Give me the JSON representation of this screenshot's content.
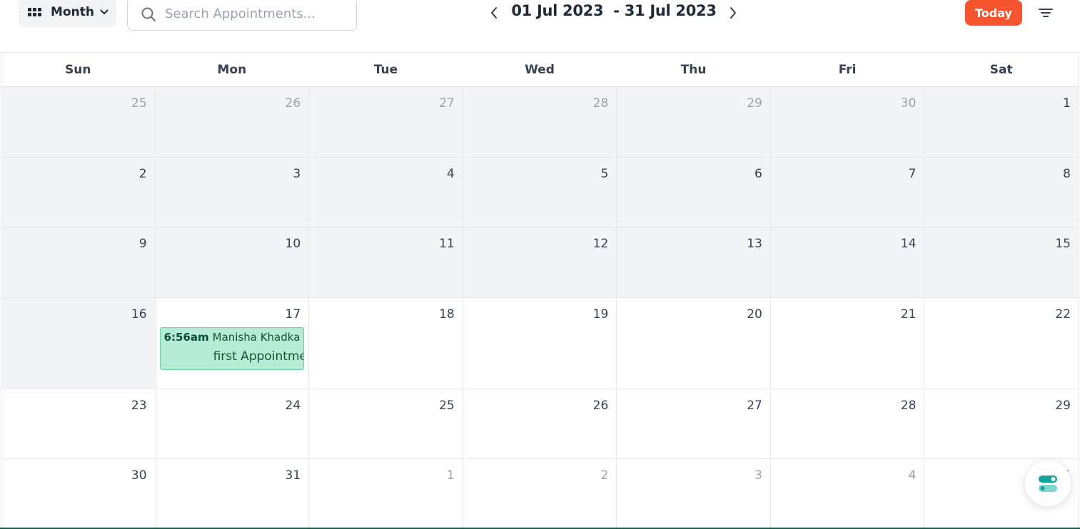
{
  "toolbar": {
    "view_label": "Month",
    "search_placeholder": "Search Appointments...",
    "search_value": "",
    "date_range": "01 Jul 2023  - 31 Jul 2023",
    "today_label": "Today"
  },
  "calendar": {
    "weekdays": [
      "Sun",
      "Mon",
      "Tue",
      "Wed",
      "Thu",
      "Fri",
      "Sat"
    ],
    "weeks": [
      [
        {
          "d": "25",
          "o": 1,
          "p": 1
        },
        {
          "d": "26",
          "o": 1,
          "p": 1
        },
        {
          "d": "27",
          "o": 1,
          "p": 1
        },
        {
          "d": "28",
          "o": 1,
          "p": 1
        },
        {
          "d": "29",
          "o": 1,
          "p": 1
        },
        {
          "d": "30",
          "o": 1,
          "p": 1
        },
        {
          "d": "1",
          "o": 0,
          "p": 1
        }
      ],
      [
        {
          "d": "2",
          "o": 0,
          "p": 1
        },
        {
          "d": "3",
          "o": 0,
          "p": 1
        },
        {
          "d": "4",
          "o": 0,
          "p": 1
        },
        {
          "d": "5",
          "o": 0,
          "p": 1
        },
        {
          "d": "6",
          "o": 0,
          "p": 1
        },
        {
          "d": "7",
          "o": 0,
          "p": 1
        },
        {
          "d": "8",
          "o": 0,
          "p": 1
        }
      ],
      [
        {
          "d": "9",
          "o": 0,
          "p": 1
        },
        {
          "d": "10",
          "o": 0,
          "p": 1
        },
        {
          "d": "11",
          "o": 0,
          "p": 1
        },
        {
          "d": "12",
          "o": 0,
          "p": 1
        },
        {
          "d": "13",
          "o": 0,
          "p": 1
        },
        {
          "d": "14",
          "o": 0,
          "p": 1
        },
        {
          "d": "15",
          "o": 0,
          "p": 1
        }
      ],
      [
        {
          "d": "16",
          "o": 0,
          "p": 1
        },
        {
          "d": "17",
          "o": 0,
          "p": 0
        },
        {
          "d": "18",
          "o": 0,
          "p": 0
        },
        {
          "d": "19",
          "o": 0,
          "p": 0
        },
        {
          "d": "20",
          "o": 0,
          "p": 0
        },
        {
          "d": "21",
          "o": 0,
          "p": 0
        },
        {
          "d": "22",
          "o": 0,
          "p": 0
        }
      ],
      [
        {
          "d": "23",
          "o": 0,
          "p": 0
        },
        {
          "d": "24",
          "o": 0,
          "p": 0
        },
        {
          "d": "25",
          "o": 0,
          "p": 0
        },
        {
          "d": "26",
          "o": 0,
          "p": 0
        },
        {
          "d": "27",
          "o": 0,
          "p": 0
        },
        {
          "d": "28",
          "o": 0,
          "p": 0
        },
        {
          "d": "29",
          "o": 0,
          "p": 0
        }
      ],
      [
        {
          "d": "30",
          "o": 0,
          "p": 0
        },
        {
          "d": "31",
          "o": 0,
          "p": 0
        },
        {
          "d": "1",
          "o": 1,
          "p": 0
        },
        {
          "d": "2",
          "o": 1,
          "p": 0
        },
        {
          "d": "3",
          "o": 1,
          "p": 0
        },
        {
          "d": "4",
          "o": 1,
          "p": 0
        },
        {
          "d": "5",
          "o": 1,
          "p": 0
        }
      ]
    ],
    "events": [
      {
        "day": "17",
        "time": "6:56am",
        "name": "Manisha Khadka",
        "title": "first Appointment"
      }
    ]
  },
  "colors": {
    "accent": "#f5542e",
    "event_bg": "#b5ecd5",
    "past_bg": "#f3f4f6",
    "fab_teal": "#14a39a"
  },
  "icons": {
    "view": "grid-icon",
    "view_dropdown": "chevron-down-icon",
    "search": "search-icon",
    "prev": "chevron-left-icon",
    "next": "chevron-right-icon",
    "filter": "filter-icon",
    "fab": "toggle-switches-icon"
  }
}
